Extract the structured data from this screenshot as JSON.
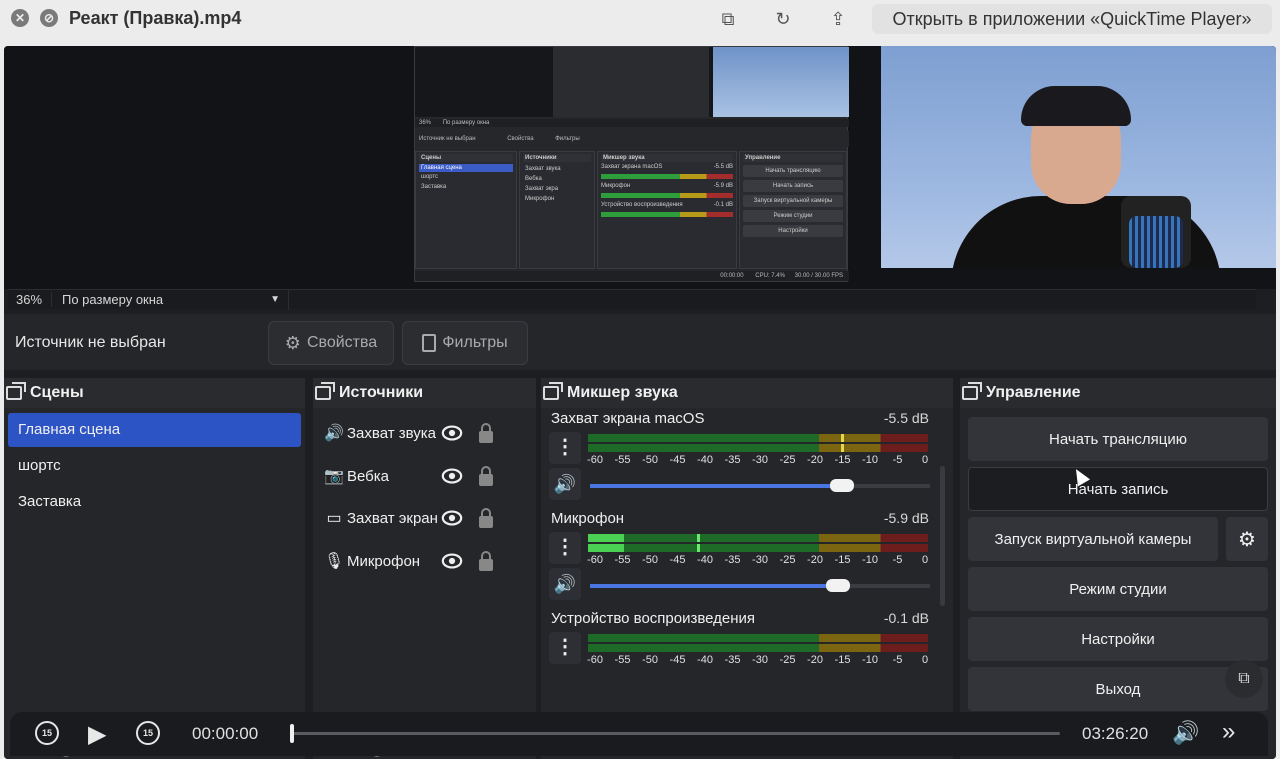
{
  "window": {
    "title": "Реакт (Правка).mp4",
    "open_in_app": "Открыть в приложении «QuickTime Player»"
  },
  "preview": {
    "zoom_percent": "36%",
    "zoom_mode": "По размеру окна",
    "nested": {
      "zoom_percent": "36%",
      "zoom_mode": "По размеру окна",
      "source_label": "Источник не выбран",
      "properties": "Свойства",
      "filters": "Фильтры",
      "scenes_header": "Сцены",
      "scenes": [
        "Главная сцена",
        "шортс",
        "Заставка"
      ],
      "sources_header": "Источники",
      "sources": [
        "Захват звука",
        "Вебка",
        "Захват экра",
        "Микрофон"
      ],
      "mixer_header": "Микшер звука",
      "mixer": [
        {
          "name": "Захват экрана macOS",
          "db": "-5.5 dB"
        },
        {
          "name": "Микрофон",
          "db": "-5.9 dB"
        },
        {
          "name": "Устройство воспроизведения",
          "db": "-0.1 dB"
        }
      ],
      "controls_header": "Управление",
      "controls": [
        "Начать трансляцию",
        "Начать запись",
        "Запуск виртуальной камеры",
        "Режим студии",
        "Настройки",
        "Выход"
      ],
      "status": {
        "time": "00:00:00",
        "cpu": "CPU: 7.4%",
        "fps": "30.00 / 30.00 FPS"
      }
    }
  },
  "source_bar": {
    "label": "Источник не выбран",
    "properties": "Свойства",
    "filters": "Фильтры"
  },
  "scenes": {
    "header": "Сцены",
    "items": [
      "Главная сцена",
      "шортс",
      "Заставка"
    ],
    "active_index": 0
  },
  "sources": {
    "header": "Источники",
    "items": [
      {
        "name": "Захват звука",
        "icon": "speaker-icon"
      },
      {
        "name": "Вебка",
        "icon": "camera-icon"
      },
      {
        "name": "Захват экрана",
        "icon": "monitor-icon"
      },
      {
        "name": "Микрофон",
        "icon": "microphone-icon"
      }
    ]
  },
  "mixer": {
    "header": "Микшер звука",
    "ticks": [
      "-60",
      "-55",
      "-50",
      "-45",
      "-40",
      "-35",
      "-30",
      "-25",
      "-20",
      "-15",
      "-10",
      "-5",
      "0"
    ],
    "channels": [
      {
        "name": "Захват экрана macOS",
        "db": "-5.5 dB",
        "level": 0.0,
        "peak": 0.745,
        "volume": 0.74
      },
      {
        "name": "Микрофон",
        "db": "-5.9 dB",
        "level": 0.105,
        "peak": 0.32,
        "volume": 0.73
      },
      {
        "name": "Устройство воспроизведения",
        "db": "-0.1 dB",
        "level": 0.0,
        "peak": 0.0,
        "volume": 0.9
      }
    ]
  },
  "controls": {
    "header": "Управление",
    "start_stream": "Начать трансляцию",
    "start_record": "Начать запись",
    "virtual_camera": "Запуск виртуальной камеры",
    "studio_mode": "Режим студии",
    "settings": "Настройки",
    "exit": "Выход"
  },
  "player": {
    "skip_back": "15",
    "skip_forward": "15",
    "current_time": "00:00:00",
    "duration": "03:26:20",
    "progress": 0.0
  },
  "colors": {
    "accent": "#2d54c4",
    "panel": "#252629",
    "button": "#33343a",
    "meter_green": "#1e6b27",
    "meter_yellow": "#7c6511",
    "meter_red": "#6e1d1d"
  }
}
